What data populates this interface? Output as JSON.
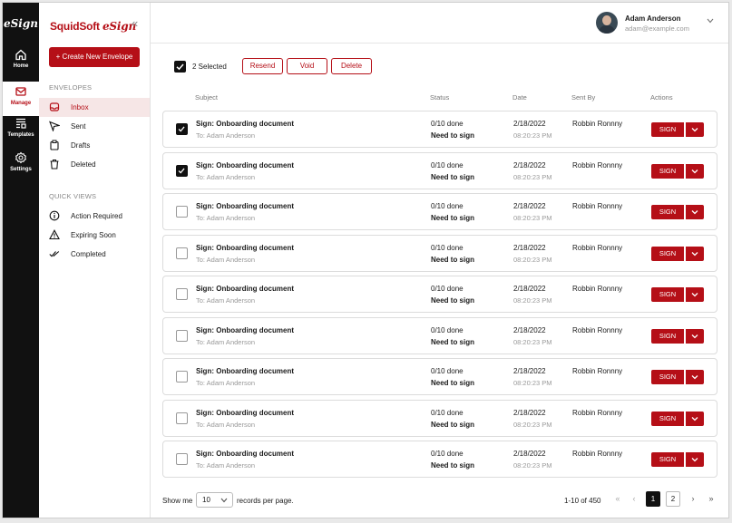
{
  "app": {
    "logo": "eSign"
  },
  "rail": {
    "items": [
      {
        "label": "Home"
      },
      {
        "label": "Manage"
      },
      {
        "label": "Templates"
      },
      {
        "label": "Settings"
      }
    ]
  },
  "sidebar": {
    "brand_main": "SquidSoft ",
    "brand_script": "eSign",
    "create_label": "+ Create New Envelope",
    "envelopes_title": "ENVELOPES",
    "envelopes": [
      {
        "label": "Inbox"
      },
      {
        "label": "Sent"
      },
      {
        "label": "Drafts"
      },
      {
        "label": "Deleted"
      }
    ],
    "quick_views_title": "QUICK VIEWS",
    "quick_views": [
      {
        "label": "Action Required"
      },
      {
        "label": "Expiring Soon"
      },
      {
        "label": "Completed"
      }
    ]
  },
  "user": {
    "name": "Adam Anderson",
    "email": "adam@example.com"
  },
  "toolbar": {
    "selected_label": "2 Selected",
    "resend_label": "Resend",
    "void_label": "Void",
    "delete_label": "Delete"
  },
  "table": {
    "headers": {
      "subject": "Subject",
      "status": "Status",
      "date": "Date",
      "sent_by": "Sent By",
      "actions": "Actions"
    },
    "sign_label": "SIGN",
    "rows": [
      {
        "checked": true,
        "subject": "Sign: Onboarding document",
        "to": "To: Adam Anderson",
        "progress": "0/10 done",
        "status": "Need to sign",
        "date": "2/18/2022",
        "time": "08:20:23 PM",
        "sent_by": "Robbin Ronnny"
      },
      {
        "checked": true,
        "subject": "Sign: Onboarding document",
        "to": "To: Adam Anderson",
        "progress": "0/10 done",
        "status": "Need to sign",
        "date": "2/18/2022",
        "time": "08:20:23 PM",
        "sent_by": "Robbin Ronnny"
      },
      {
        "checked": false,
        "subject": "Sign: Onboarding document",
        "to": "To: Adam Anderson",
        "progress": "0/10 done",
        "status": "Need to sign",
        "date": "2/18/2022",
        "time": "08:20:23 PM",
        "sent_by": "Robbin Ronnny"
      },
      {
        "checked": false,
        "subject": "Sign: Onboarding document",
        "to": "To: Adam Anderson",
        "progress": "0/10 done",
        "status": "Need to sign",
        "date": "2/18/2022",
        "time": "08:20:23 PM",
        "sent_by": "Robbin Ronnny"
      },
      {
        "checked": false,
        "subject": "Sign: Onboarding document",
        "to": "To: Adam Anderson",
        "progress": "0/10 done",
        "status": "Need to sign",
        "date": "2/18/2022",
        "time": "08:20:23 PM",
        "sent_by": "Robbin Ronnny"
      },
      {
        "checked": false,
        "subject": "Sign: Onboarding document",
        "to": "To: Adam Anderson",
        "progress": "0/10 done",
        "status": "Need to sign",
        "date": "2/18/2022",
        "time": "08:20:23 PM",
        "sent_by": "Robbin Ronnny"
      },
      {
        "checked": false,
        "subject": "Sign: Onboarding document",
        "to": "To: Adam Anderson",
        "progress": "0/10 done",
        "status": "Need to sign",
        "date": "2/18/2022",
        "time": "08:20:23 PM",
        "sent_by": "Robbin Ronnny"
      },
      {
        "checked": false,
        "subject": "Sign: Onboarding document",
        "to": "To: Adam Anderson",
        "progress": "0/10 done",
        "status": "Need to sign",
        "date": "2/18/2022",
        "time": "08:20:23 PM",
        "sent_by": "Robbin Ronnny"
      },
      {
        "checked": false,
        "subject": "Sign: Onboarding document",
        "to": "To: Adam Anderson",
        "progress": "0/10 done",
        "status": "Need to sign",
        "date": "2/18/2022",
        "time": "08:20:23 PM",
        "sent_by": "Robbin Ronnny"
      }
    ]
  },
  "footer": {
    "show_me": "Show me",
    "per_page": "10",
    "records_label": "records per page.",
    "range": "1-10 of 450",
    "pages": [
      "1",
      "2"
    ]
  },
  "colors": {
    "brand": "#b50f17",
    "rail": "#111111",
    "active_bg": "#f6e6e6"
  }
}
